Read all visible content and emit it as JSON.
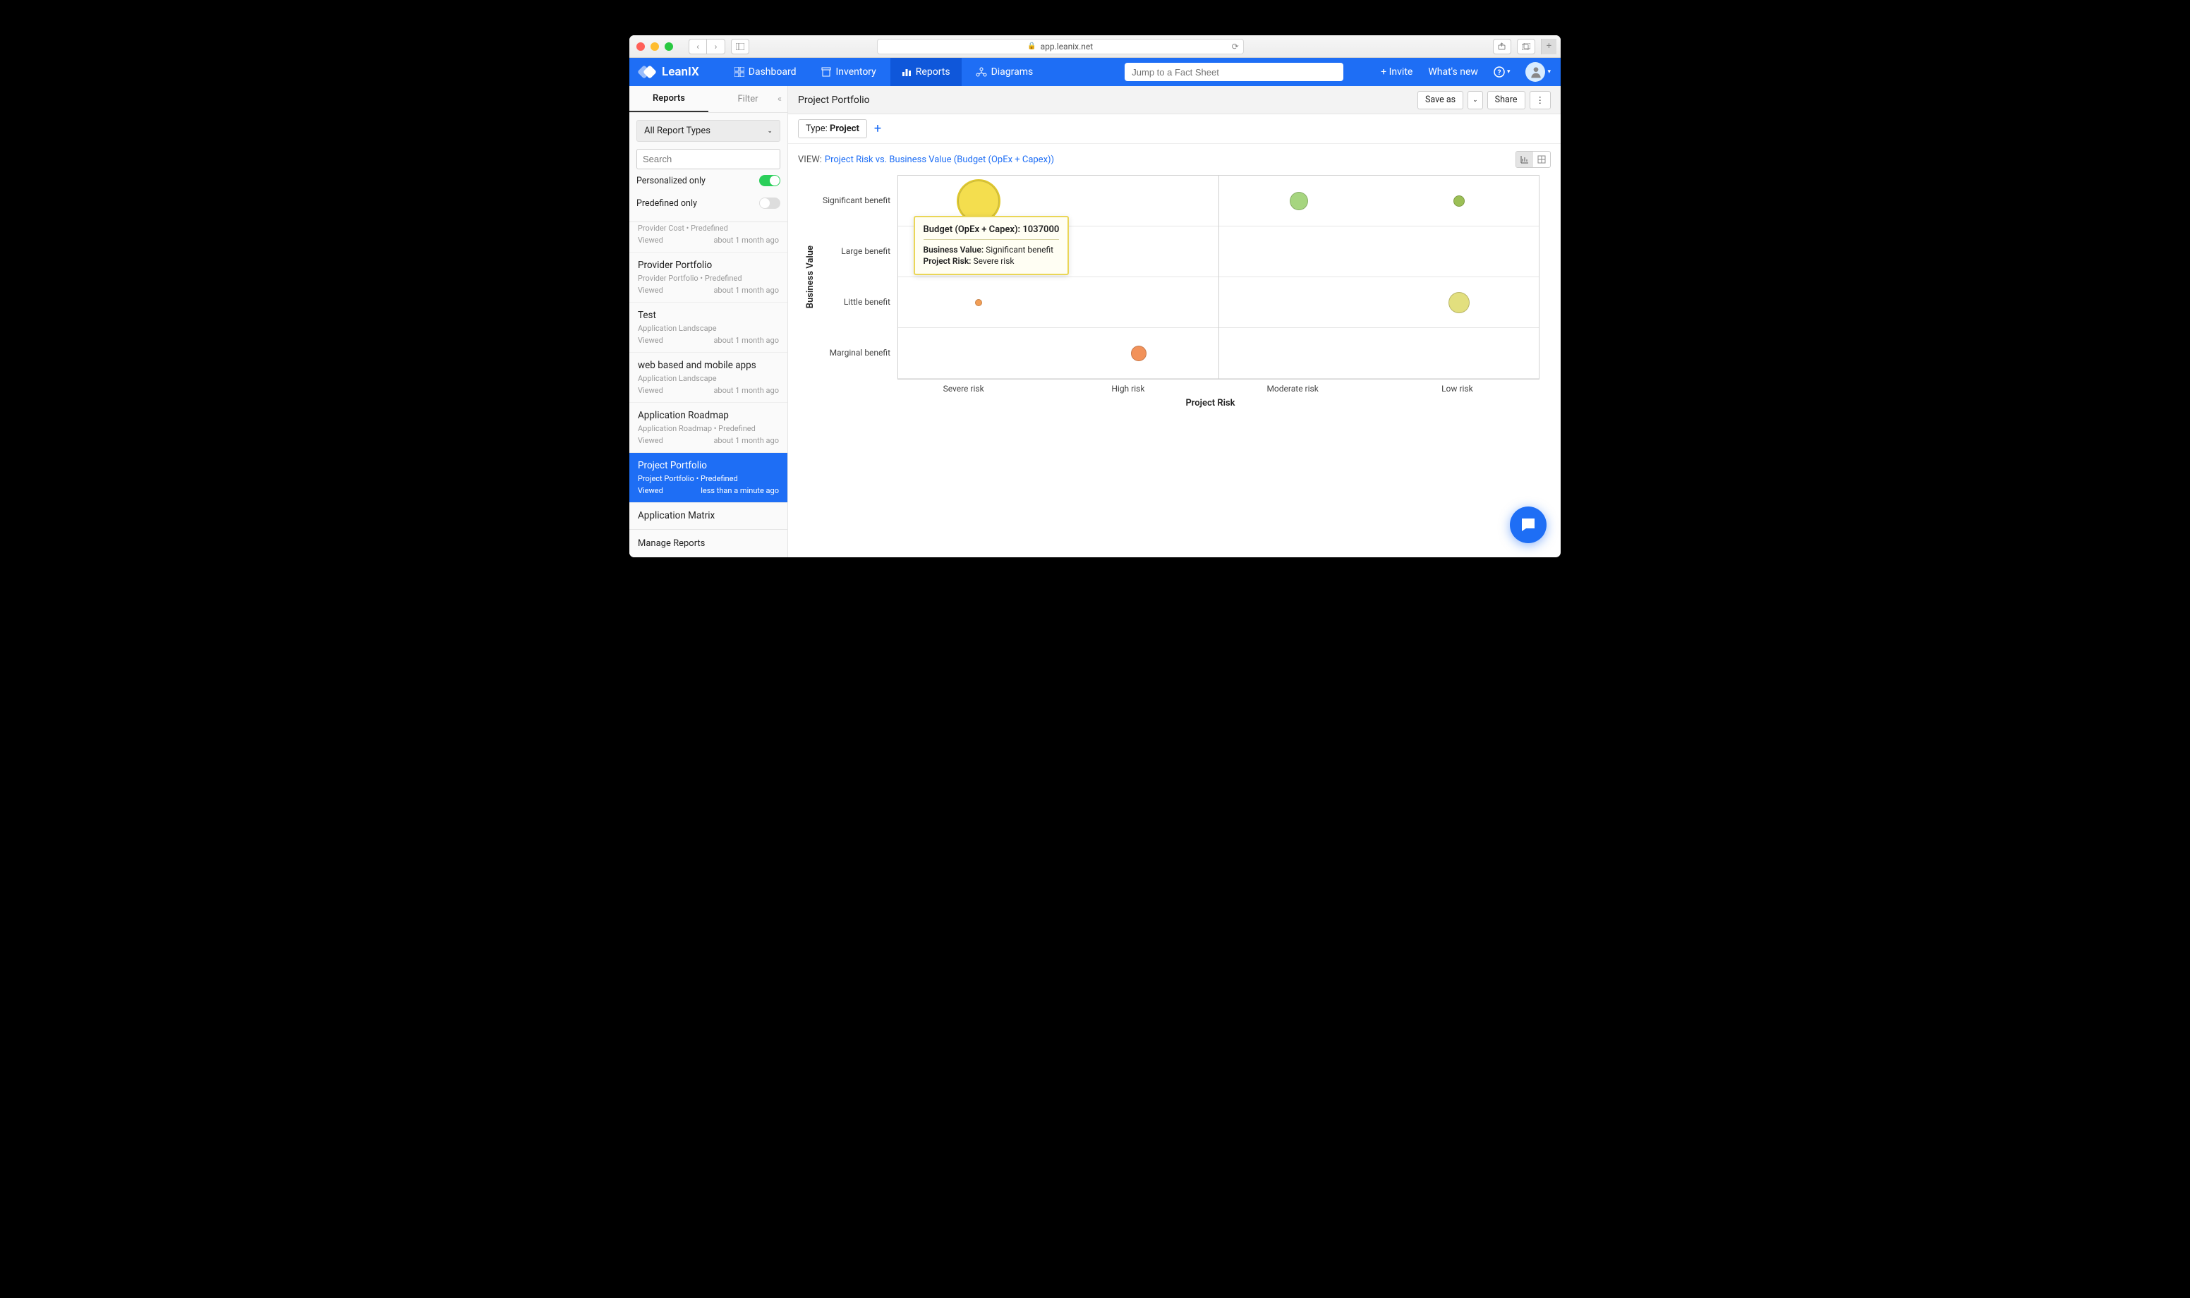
{
  "browser": {
    "url": "app.leanix.net"
  },
  "brand": "LeanIX",
  "nav": {
    "dashboard": "Dashboard",
    "inventory": "Inventory",
    "reports": "Reports",
    "diagrams": "Diagrams"
  },
  "search_placeholder": "Jump to a Fact Sheet",
  "tail": {
    "invite": "+ Invite",
    "whatsnew": "What's new"
  },
  "sidebar": {
    "tabs": {
      "reports": "Reports",
      "filter": "Filter"
    },
    "dropdown": "All Report Types",
    "search_placeholder": "Search",
    "toggles": {
      "personalized": "Personalized only",
      "predefined": "Predefined only"
    },
    "items": [
      {
        "title": "",
        "meta": "Provider Cost • Predefined",
        "viewed": "Viewed",
        "ago": "about 1 month ago",
        "truncated_top": true
      },
      {
        "title": "Provider Portfolio",
        "meta": "Provider Portfolio • Predefined",
        "viewed": "Viewed",
        "ago": "about 1 month ago"
      },
      {
        "title": "Test",
        "meta": "Application Landscape",
        "viewed": "Viewed",
        "ago": "about 1 month ago"
      },
      {
        "title": "web based and mobile apps",
        "meta": "Application Landscape",
        "viewed": "Viewed",
        "ago": "about 1 month ago"
      },
      {
        "title": "Application Roadmap",
        "meta": "Application Roadmap • Predefined",
        "viewed": "Viewed",
        "ago": "about 1 month ago"
      },
      {
        "title": "Project Portfolio",
        "meta": "Project Portfolio • Predefined",
        "viewed": "Viewed",
        "ago": "less than a minute ago",
        "active": true
      },
      {
        "title": "Application Matrix",
        "meta": "",
        "viewed": "",
        "ago": "",
        "cut": true
      }
    ],
    "manage": "Manage Reports"
  },
  "crumb": {
    "title": "Project Portfolio",
    "saveas": "Save as",
    "share": "Share"
  },
  "filter": {
    "type_label": "Type:",
    "type_value": "Project"
  },
  "view": {
    "label": "VIEW:",
    "value": "Project Risk vs. Business Value (Budget (OpEx + Capex))"
  },
  "chart_data": {
    "type": "scatter",
    "xlabel": "Project Risk",
    "ylabel": "Business Value",
    "x_categories": [
      "Severe risk",
      "High risk",
      "Moderate risk",
      "Low risk"
    ],
    "y_categories": [
      "Significant benefit",
      "Large benefit",
      "Little benefit",
      "Marginal benefit"
    ],
    "points": [
      {
        "x": "Severe risk",
        "y": "Significant benefit",
        "size": 58,
        "color": "#f4de4e",
        "highlight": true,
        "budget": 1037000
      },
      {
        "x": "Moderate risk",
        "y": "Significant benefit",
        "size": 26,
        "color": "#a6d57f"
      },
      {
        "x": "Low risk",
        "y": "Significant benefit",
        "size": 16,
        "color": "#9bbf55"
      },
      {
        "x": "Severe risk",
        "y": "Little benefit",
        "size": 10,
        "color": "#f29e56"
      },
      {
        "x": "Low risk",
        "y": "Little benefit",
        "size": 30,
        "color": "#e2df7e"
      },
      {
        "x": "High risk",
        "y": "Marginal benefit",
        "size": 22,
        "color": "#f2925a"
      }
    ]
  },
  "tooltip": {
    "header_label": "Budget (OpEx + Capex):",
    "header_value": "1037000",
    "bv_label": "Business Value:",
    "bv_value": "Significant benefit",
    "pr_label": "Project Risk:",
    "pr_value": "Severe risk"
  }
}
